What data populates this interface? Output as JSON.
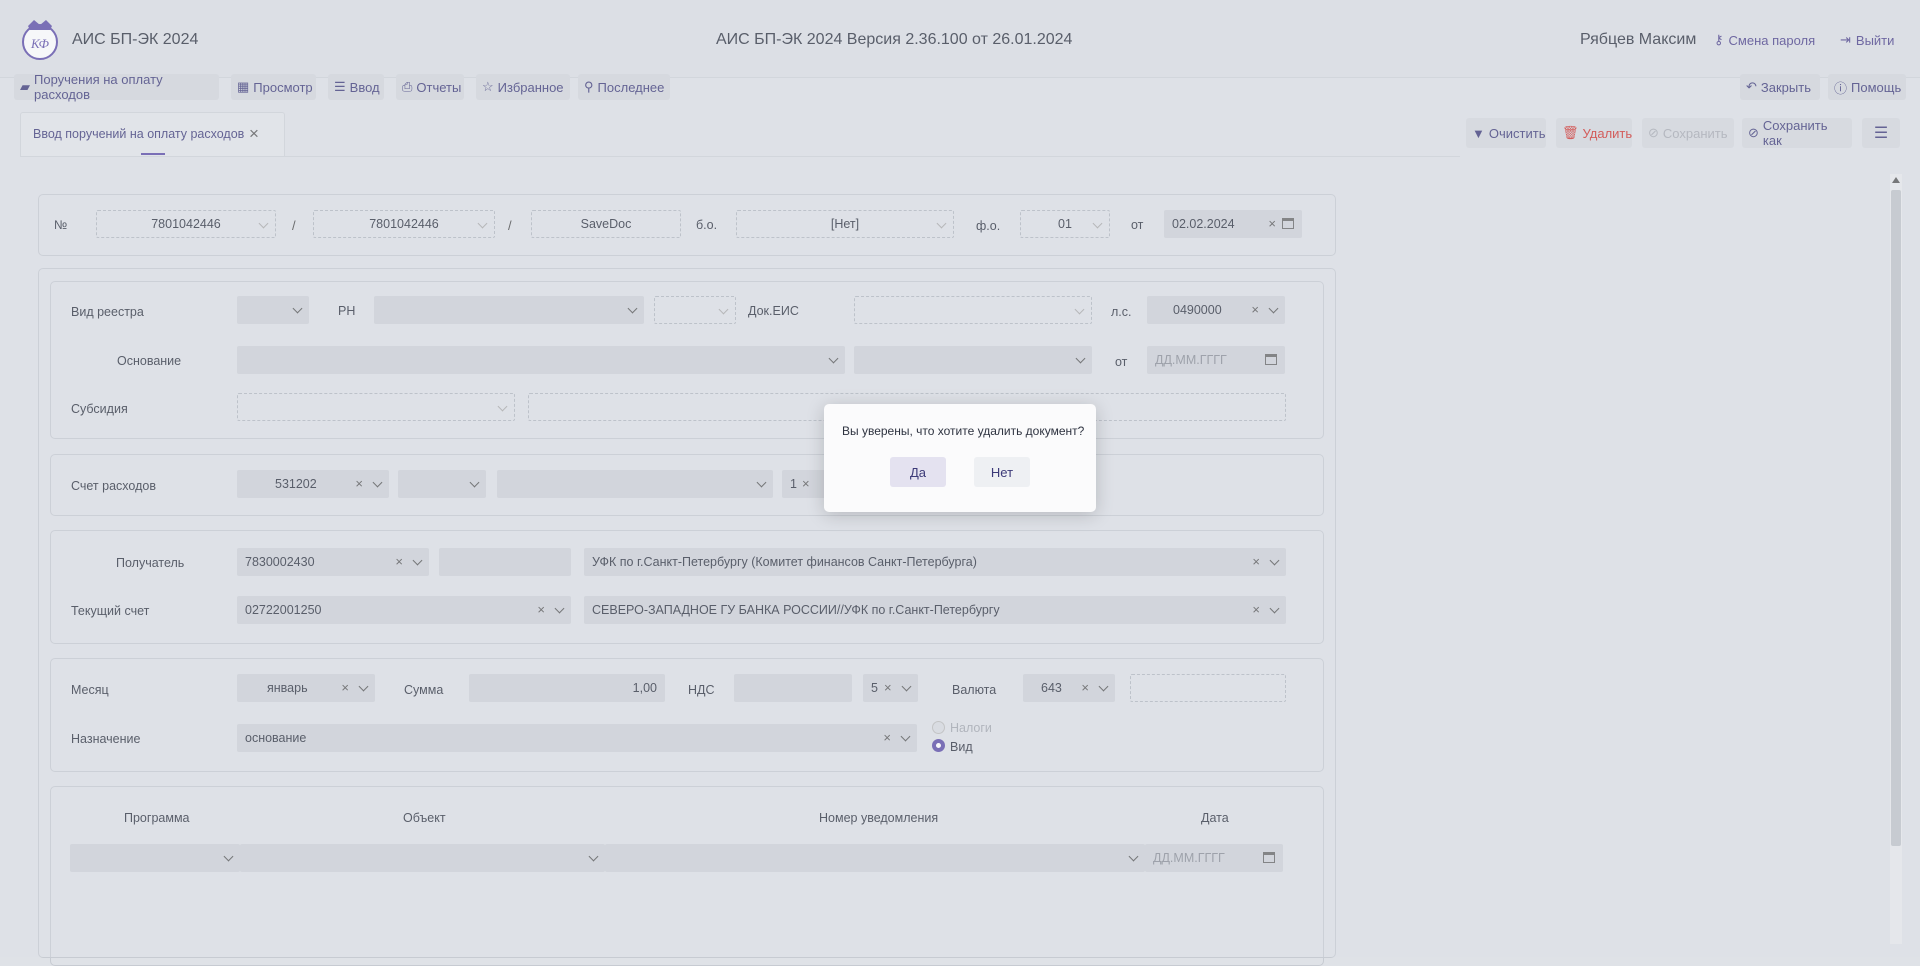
{
  "header": {
    "app_name": "АИС БП-ЭК 2024",
    "version_title": "АИС БП-ЭК 2024 Версия 2.36.100 от 26.01.2024",
    "user_name": "Рябцев Максим",
    "change_password": "Смена пароля",
    "logout": "Выйти",
    "logo_text": "КФ"
  },
  "menu": {
    "items": [
      "Поручения на оплату расходов",
      "Просмотр",
      "Ввод",
      "Отчеты",
      "Избранное",
      "Последнее"
    ],
    "close": "Закрыть",
    "help": "Помощь"
  },
  "tab": {
    "title": "Ввод поручений на оплату расходов"
  },
  "toolbar": {
    "clear": "Очистить",
    "delete": "Удалить",
    "save": "Сохранить",
    "save_as": "Сохранить как"
  },
  "doc_header": {
    "num_label": "№",
    "num1": "7801042446",
    "sep": "/",
    "num2": "7801042446",
    "num3": "SaveDoc",
    "bo_label": "б.о.",
    "bo_value": "[Нет]",
    "fo_label": "ф.о.",
    "fo_value": "01",
    "date_label": "от",
    "date_value": "02.02.2024"
  },
  "registry": {
    "vid_label": "Вид реестра",
    "rn_label": "РН",
    "doc_eis_label": "Док.ЕИС",
    "ls_label": "л.с.",
    "ls_value": "0490000",
    "osnovanie_label": "Основание",
    "ot_label": "от",
    "date_placeholder": "ДД.ММ.ГГГГ",
    "subsidy_label": "Субсидия"
  },
  "expense": {
    "label": "Счет расходов",
    "value": "531202",
    "small_value": "1"
  },
  "recipient": {
    "label": "Получатель",
    "inn": "7830002430",
    "name": "УФК по г.Санкт-Петербургу (Комитет финансов Санкт-Петербурга)",
    "account_label": "Текущий счет",
    "account": "02722001250",
    "bank": "СЕВЕРО-ЗАПАДНОЕ ГУ БАНКА РОССИИ//УФК по г.Санкт-Петербургу"
  },
  "payment": {
    "month_label": "Месяц",
    "month": "январь",
    "sum_label": "Сумма",
    "sum": "1,00",
    "nds_label": "НДС",
    "nds_rate": "5",
    "currency_label": "Валюта",
    "currency": "643",
    "purpose_label": "Назначение",
    "purpose": "основание",
    "radio_taxes": "Налоги",
    "radio_vid": "Вид"
  },
  "program": {
    "col_program": "Программа",
    "col_object": "Объект",
    "col_notice": "Номер уведомления",
    "col_date": "Дата",
    "date_placeholder": "ДД.ММ.ГГГГ"
  },
  "dialog": {
    "message": "Вы уверены, что хотите удалить документ?",
    "yes": "Да",
    "no": "Нет"
  },
  "colors": {
    "accent": "#5a4aa6",
    "danger": "#d0312d"
  }
}
